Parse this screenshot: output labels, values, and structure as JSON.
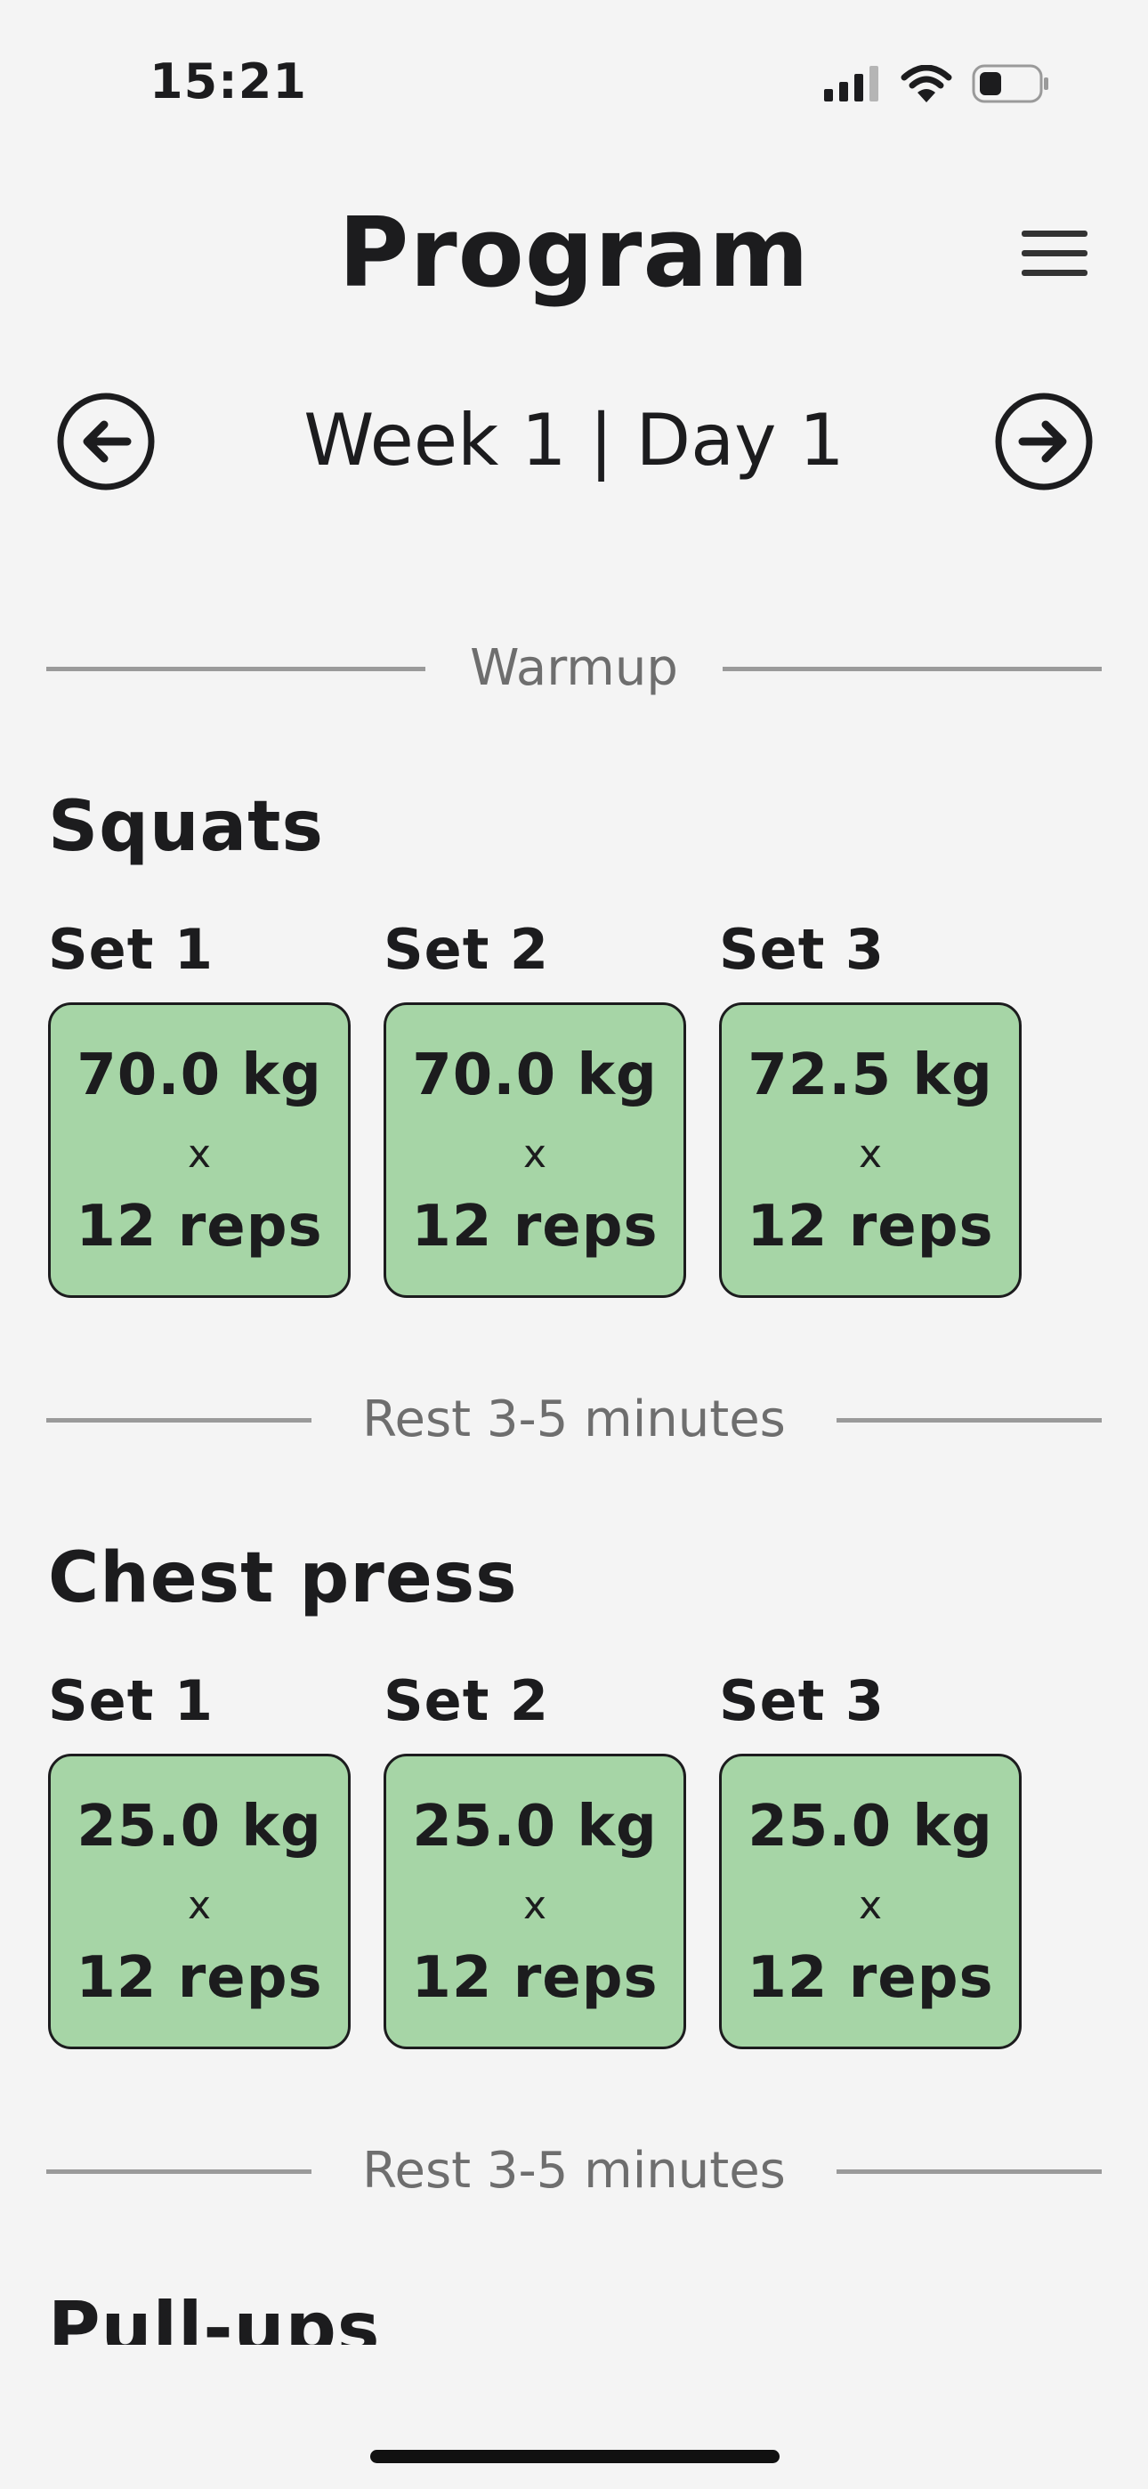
{
  "status_bar": {
    "time": "15:21",
    "icons": [
      "cellular-signal-icon",
      "wifi-icon",
      "battery-icon"
    ]
  },
  "header": {
    "title": "Program",
    "menu_icon": "hamburger-menu-icon"
  },
  "navigation": {
    "label": "Week 1 | Day 1",
    "prev_icon": "arrow-left-circle-icon",
    "next_icon": "arrow-right-circle-icon"
  },
  "sections": {
    "warmup": "Warmup"
  },
  "exercises": [
    {
      "name": "Squats",
      "sets": [
        {
          "label": "Set 1",
          "weight": "70.0 kg",
          "times": "x",
          "reps": "12 reps"
        },
        {
          "label": "Set 2",
          "weight": "70.0 kg",
          "times": "x",
          "reps": "12 reps"
        },
        {
          "label": "Set 3",
          "weight": "72.5 kg",
          "times": "x",
          "reps": "12 reps"
        }
      ],
      "rest": "Rest 3-5 minutes"
    },
    {
      "name": "Chest press",
      "sets": [
        {
          "label": "Set 1",
          "weight": "25.0 kg",
          "times": "x",
          "reps": "12 reps"
        },
        {
          "label": "Set 2",
          "weight": "25.0 kg",
          "times": "x",
          "reps": "12 reps"
        },
        {
          "label": "Set 3",
          "weight": "25.0 kg",
          "times": "x",
          "reps": "12 reps"
        }
      ],
      "rest": "Rest 3-5 minutes"
    },
    {
      "name": "Pull-ups"
    }
  ],
  "colors": {
    "background": "#f4f4f4",
    "set_card": "#a6d5a6",
    "text": "#1c1c1e",
    "divider": "#9a9a9a",
    "divider_text": "#6e6e6e"
  }
}
